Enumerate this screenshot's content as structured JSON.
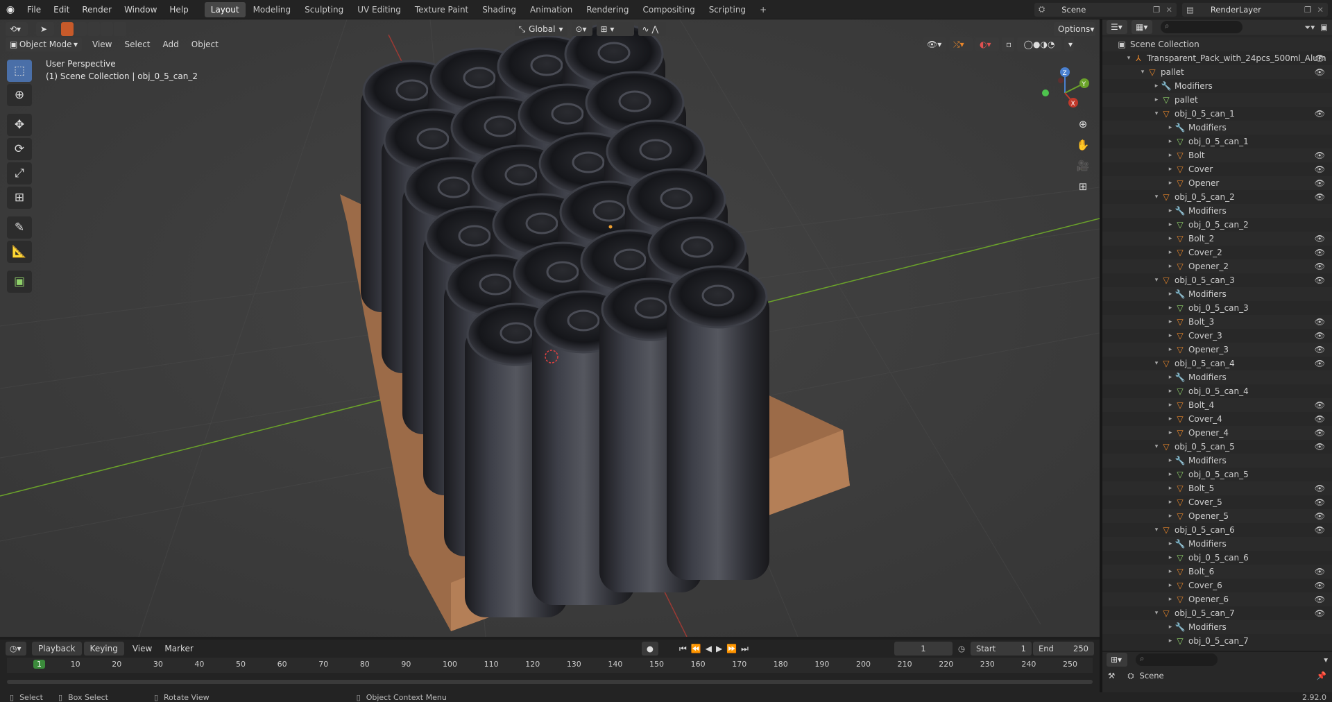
{
  "menu": [
    "File",
    "Edit",
    "Render",
    "Window",
    "Help"
  ],
  "workspaces": [
    "Layout",
    "Modeling",
    "Sculpting",
    "UV Editing",
    "Texture Paint",
    "Shading",
    "Animation",
    "Rendering",
    "Compositing",
    "Scripting"
  ],
  "active_workspace": "Layout",
  "scene_name": "Scene",
  "render_layer": "RenderLayer",
  "viewport": {
    "mode": "Object Mode",
    "menus": [
      "View",
      "Select",
      "Add",
      "Object"
    ],
    "orientation": "Global",
    "options_label": "Options",
    "perspective_label": "User Perspective",
    "collection_label": "(1) Scene Collection | obj_0_5_can_2"
  },
  "outliner": {
    "root": "Scene Collection",
    "rows": [
      {
        "label": "Transparent_Pack_with_24pcs_500ml_Alum",
        "indent": 1,
        "icon": "armature-icon",
        "caret": "▾",
        "eye": true
      },
      {
        "label": "pallet",
        "indent": 2,
        "icon": "object-icon",
        "caret": "▾",
        "eye": true
      },
      {
        "label": "Modifiers",
        "indent": 3,
        "icon": "wrench-icon",
        "caret": "▸",
        "eye": false
      },
      {
        "label": "pallet",
        "indent": 3,
        "icon": "mesh-icon",
        "caret": "▸",
        "eye": false
      },
      {
        "label": "obj_0_5_can_1",
        "indent": 3,
        "icon": "object-icon",
        "caret": "▾",
        "eye": true
      },
      {
        "label": "Modifiers",
        "indent": 4,
        "icon": "wrench-icon",
        "caret": "▸",
        "eye": false
      },
      {
        "label": "obj_0_5_can_1",
        "indent": 4,
        "icon": "mesh-icon",
        "caret": "▸",
        "eye": false
      },
      {
        "label": "Bolt",
        "indent": 4,
        "icon": "object-icon",
        "caret": "▸",
        "eye": true
      },
      {
        "label": "Cover",
        "indent": 4,
        "icon": "object-icon",
        "caret": "▸",
        "eye": true
      },
      {
        "label": "Opener",
        "indent": 4,
        "icon": "object-icon",
        "caret": "▸",
        "eye": true
      },
      {
        "label": "obj_0_5_can_2",
        "indent": 3,
        "icon": "object-icon",
        "caret": "▾",
        "eye": true
      },
      {
        "label": "Modifiers",
        "indent": 4,
        "icon": "wrench-icon",
        "caret": "▸",
        "eye": false
      },
      {
        "label": "obj_0_5_can_2",
        "indent": 4,
        "icon": "mesh-icon",
        "caret": "▸",
        "eye": false
      },
      {
        "label": "Bolt_2",
        "indent": 4,
        "icon": "object-icon",
        "caret": "▸",
        "eye": true
      },
      {
        "label": "Cover_2",
        "indent": 4,
        "icon": "object-icon",
        "caret": "▸",
        "eye": true
      },
      {
        "label": "Opener_2",
        "indent": 4,
        "icon": "object-icon",
        "caret": "▸",
        "eye": true
      },
      {
        "label": "obj_0_5_can_3",
        "indent": 3,
        "icon": "object-icon",
        "caret": "▾",
        "eye": true
      },
      {
        "label": "Modifiers",
        "indent": 4,
        "icon": "wrench-icon",
        "caret": "▸",
        "eye": false
      },
      {
        "label": "obj_0_5_can_3",
        "indent": 4,
        "icon": "mesh-icon",
        "caret": "▸",
        "eye": false
      },
      {
        "label": "Bolt_3",
        "indent": 4,
        "icon": "object-icon",
        "caret": "▸",
        "eye": true
      },
      {
        "label": "Cover_3",
        "indent": 4,
        "icon": "object-icon",
        "caret": "▸",
        "eye": true
      },
      {
        "label": "Opener_3",
        "indent": 4,
        "icon": "object-icon",
        "caret": "▸",
        "eye": true
      },
      {
        "label": "obj_0_5_can_4",
        "indent": 3,
        "icon": "object-icon",
        "caret": "▾",
        "eye": true
      },
      {
        "label": "Modifiers",
        "indent": 4,
        "icon": "wrench-icon",
        "caret": "▸",
        "eye": false
      },
      {
        "label": "obj_0_5_can_4",
        "indent": 4,
        "icon": "mesh-icon",
        "caret": "▸",
        "eye": false
      },
      {
        "label": "Bolt_4",
        "indent": 4,
        "icon": "object-icon",
        "caret": "▸",
        "eye": true
      },
      {
        "label": "Cover_4",
        "indent": 4,
        "icon": "object-icon",
        "caret": "▸",
        "eye": true
      },
      {
        "label": "Opener_4",
        "indent": 4,
        "icon": "object-icon",
        "caret": "▸",
        "eye": true
      },
      {
        "label": "obj_0_5_can_5",
        "indent": 3,
        "icon": "object-icon",
        "caret": "▾",
        "eye": true
      },
      {
        "label": "Modifiers",
        "indent": 4,
        "icon": "wrench-icon",
        "caret": "▸",
        "eye": false
      },
      {
        "label": "obj_0_5_can_5",
        "indent": 4,
        "icon": "mesh-icon",
        "caret": "▸",
        "eye": false
      },
      {
        "label": "Bolt_5",
        "indent": 4,
        "icon": "object-icon",
        "caret": "▸",
        "eye": true
      },
      {
        "label": "Cover_5",
        "indent": 4,
        "icon": "object-icon",
        "caret": "▸",
        "eye": true
      },
      {
        "label": "Opener_5",
        "indent": 4,
        "icon": "object-icon",
        "caret": "▸",
        "eye": true
      },
      {
        "label": "obj_0_5_can_6",
        "indent": 3,
        "icon": "object-icon",
        "caret": "▾",
        "eye": true
      },
      {
        "label": "Modifiers",
        "indent": 4,
        "icon": "wrench-icon",
        "caret": "▸",
        "eye": false
      },
      {
        "label": "obj_0_5_can_6",
        "indent": 4,
        "icon": "mesh-icon",
        "caret": "▸",
        "eye": false
      },
      {
        "label": "Bolt_6",
        "indent": 4,
        "icon": "object-icon",
        "caret": "▸",
        "eye": true
      },
      {
        "label": "Cover_6",
        "indent": 4,
        "icon": "object-icon",
        "caret": "▸",
        "eye": true
      },
      {
        "label": "Opener_6",
        "indent": 4,
        "icon": "object-icon",
        "caret": "▸",
        "eye": true
      },
      {
        "label": "obj_0_5_can_7",
        "indent": 3,
        "icon": "object-icon",
        "caret": "▾",
        "eye": true
      },
      {
        "label": "Modifiers",
        "indent": 4,
        "icon": "wrench-icon",
        "caret": "▸",
        "eye": false
      },
      {
        "label": "obj_0_5_can_7",
        "indent": 4,
        "icon": "mesh-icon",
        "caret": "▸",
        "eye": false
      }
    ]
  },
  "properties_scene": "Scene",
  "version": "2.92.0",
  "timeline": {
    "menus": [
      "Playback",
      "Keying",
      "View",
      "Marker"
    ],
    "current_frame": "1",
    "start_label": "Start",
    "start": "1",
    "end_label": "End",
    "end": "250",
    "ticks": [
      "1",
      "10",
      "20",
      "30",
      "40",
      "50",
      "60",
      "70",
      "80",
      "90",
      "100",
      "110",
      "120",
      "130",
      "140",
      "150",
      "160",
      "170",
      "180",
      "190",
      "200",
      "210",
      "220",
      "230",
      "240",
      "250"
    ]
  },
  "status": {
    "select": "Select",
    "box_select": "Box Select",
    "rotate_view": "Rotate View",
    "context_menu": "Object Context Menu"
  },
  "colors": {
    "accent": "#4a6fa8",
    "object_orange": "#e8862a",
    "mesh_green": "#8fd16a",
    "x_axis": "#c0392b",
    "y_axis": "#6ba32a"
  }
}
